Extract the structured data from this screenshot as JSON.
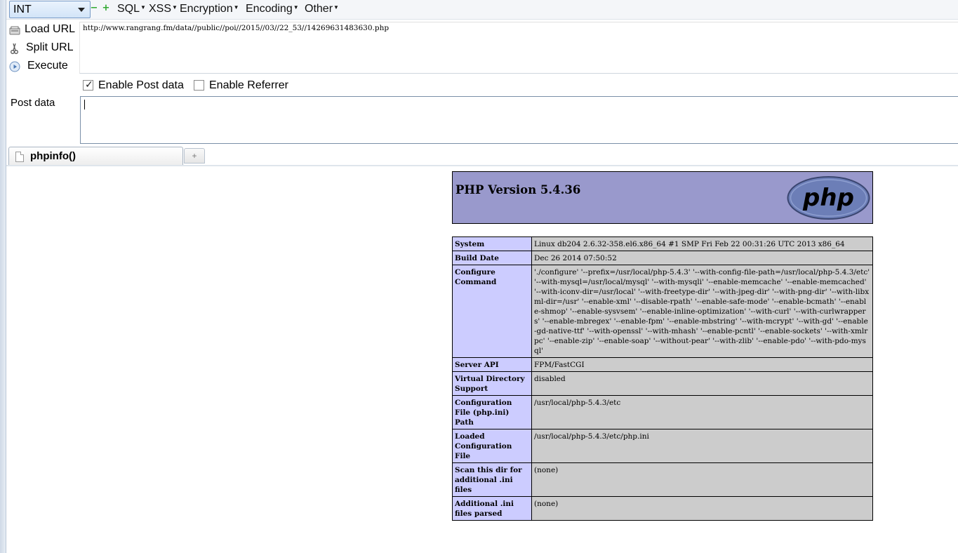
{
  "toolbar": {
    "select_value": "INT",
    "menus": [
      "SQL",
      "XSS",
      "Encryption",
      "Encoding",
      "Other"
    ]
  },
  "actions": {
    "load_url": "Load URL",
    "split_url": "Split URL",
    "execute": "Execute"
  },
  "url": "http://www.rangrang.fm/data//public//poi//2015//03//22_53//14269631483630.php",
  "options": {
    "enable_post": "Enable Post data",
    "enable_post_checked": true,
    "enable_referrer": "Enable Referrer",
    "enable_referrer_checked": false
  },
  "post": {
    "label": "Post data",
    "value": ""
  },
  "tab": {
    "title": "phpinfo()",
    "new_tab": "+"
  },
  "phpinfo": {
    "version": "PHP Version 5.4.36",
    "logo_text": "php",
    "rows": [
      {
        "key": "System",
        "value": "Linux db204 2.6.32-358.el6.x86_64 #1 SMP Fri Feb 22 00:31:26 UTC 2013 x86_64"
      },
      {
        "key": "Build Date",
        "value": "Dec 26 2014 07:50:52"
      },
      {
        "key": "Configure Command",
        "value": "'./configure' '--prefix=/usr/local/php-5.4.3' '--with-config-file-path=/usr/local/php-5.4.3/etc' '--with-mysql=/usr/local/mysql' '--with-mysqli' '--enable-memcache' '--enable-memcached' '--with-iconv-dir=/usr/local' '--with-freetype-dir' '--with-jpeg-dir' '--with-png-dir' '--with-libxml-dir=/usr' '--enable-xml' '--disable-rpath' '--enable-safe-mode' '--enable-bcmath' '--enable-shmop' '--enable-sysvsem' '--enable-inline-optimization' '--with-curl' '--with-curlwrappers' '--enable-mbregex' '--enable-fpm' '--enable-mbstring' '--with-mcrypt' '--with-gd' '--enable-gd-native-ttf' '--with-openssl' '--with-mhash' '--enable-pcntl' '--enable-sockets' '--with-xmlrpc' '--enable-zip' '--enable-soap' '--without-pear' '--with-zlib' '--enable-pdo' '--with-pdo-mysql'"
      },
      {
        "key": "Server API",
        "value": "FPM/FastCGI"
      },
      {
        "key": "Virtual Directory Support",
        "value": "disabled"
      },
      {
        "key": "Configuration File (php.ini) Path",
        "value": "/usr/local/php-5.4.3/etc"
      },
      {
        "key": "Loaded Configuration File",
        "value": "/usr/local/php-5.4.3/etc/php.ini"
      },
      {
        "key": "Scan this dir for additional .ini files",
        "value": "(none)"
      },
      {
        "key": "Additional .ini files parsed",
        "value": "(none)"
      }
    ]
  },
  "colors": {
    "header_bg": "#9999cc",
    "key_bg": "#ccccff",
    "value_bg": "#cccccc"
  }
}
